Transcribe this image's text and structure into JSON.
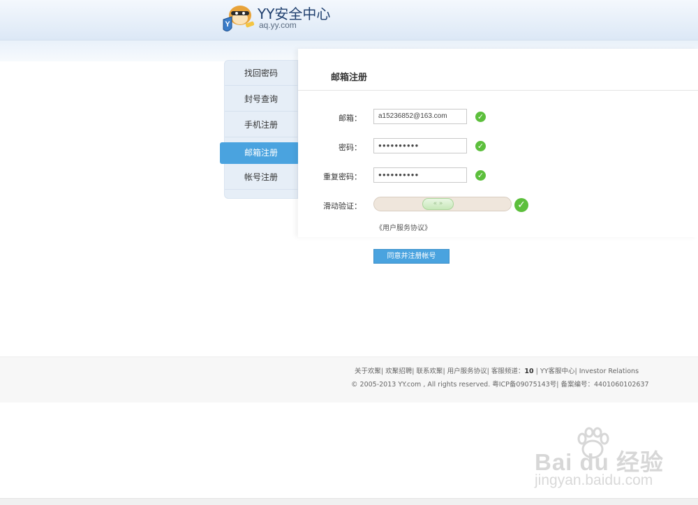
{
  "header": {
    "brand_title": "YY安全中心",
    "brand_url": "aq.yy.com",
    "logo_icon": "yy-mascot-shield-icon"
  },
  "sidebar": {
    "items": [
      {
        "label": "找回密码",
        "active": false
      },
      {
        "label": "封号查询",
        "active": false
      },
      {
        "label": "手机注册",
        "active": false
      },
      {
        "label": "邮箱注册",
        "active": true
      },
      {
        "label": "帐号注册",
        "active": false
      }
    ]
  },
  "main": {
    "title": "邮箱注册",
    "fields": {
      "email_label": "邮箱：",
      "email_value": "a15236852@163.com",
      "password_label": "密码：",
      "password_value": "●●●●●●●●●●",
      "repeat_label": "重复密码：",
      "repeat_value": "●●●●●●●●●●",
      "slider_label": "滑动验证：",
      "slider_handle_glyph": "« »",
      "check_glyph": "✓"
    },
    "agreement_link": "《用户服务协议》",
    "submit_label": "同意并注册帐号"
  },
  "footer": {
    "links_text": "关于欢聚| 欢聚招聘| 联系欢聚| 用户服务协议| 客服频道：",
    "channel_number": "10",
    "links_text_tail": " | YY客服中心| Investor Relations",
    "copyright": "© 2005-2013 YY.com , All rights reserved. 粤ICP备09075143号| 备案编号：4401060102637"
  },
  "watermark": {
    "logo_text": "Bai du 经验",
    "sub_text": "jingyan.baidu.com"
  },
  "colors": {
    "accent": "#4aa3df",
    "success": "#5cbf3c",
    "sidebar_bg": "#e6eef7"
  }
}
